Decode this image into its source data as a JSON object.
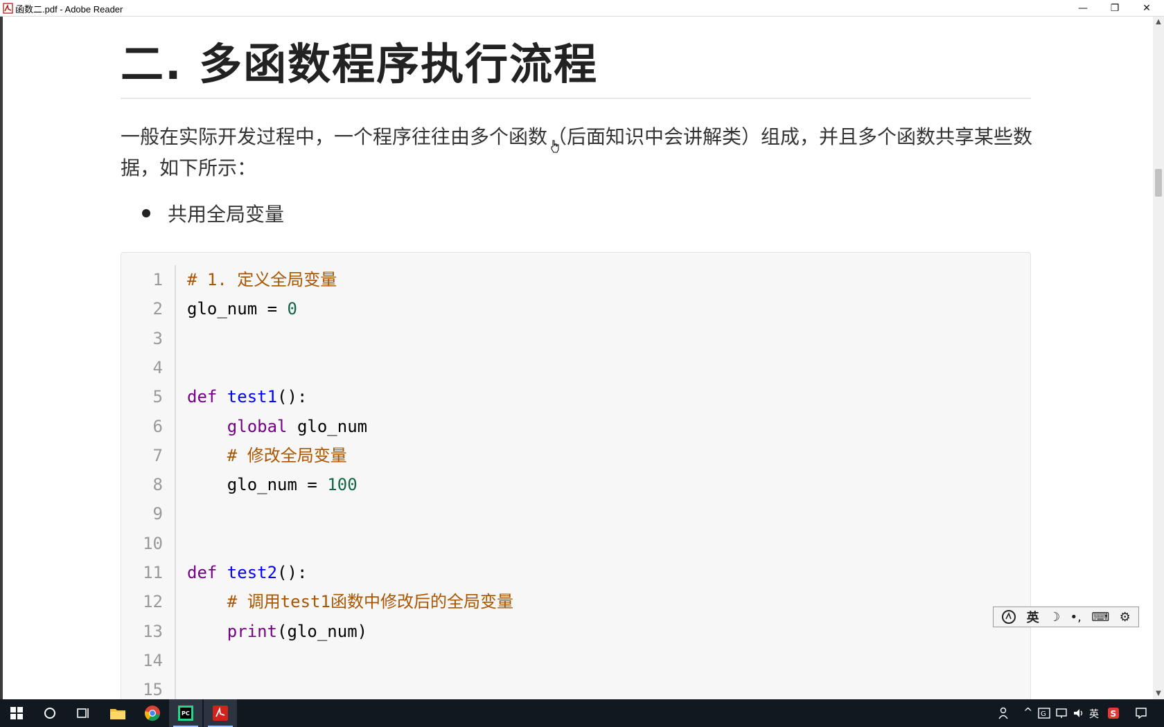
{
  "window": {
    "title": "函数二.pdf - Adobe Reader",
    "minimize_glyph": "—",
    "restore_glyph": "❐",
    "close_glyph": "✕"
  },
  "document": {
    "title": "二. 多函数程序执行流程",
    "paragraph": "一般在实际开发过程中，一个程序往往由多个函数（后面知识中会讲解类）组成，并且多个函数共享某些数据，如下所示：",
    "bullet": "共用全局变量",
    "code_lines": [
      {
        "n": "1",
        "tokens": [
          {
            "t": "# 1. 定义全局变量",
            "c": "c-comment"
          }
        ]
      },
      {
        "n": "2",
        "tokens": [
          {
            "t": "glo_num = ",
            "c": "c-plain"
          },
          {
            "t": "0",
            "c": "c-num"
          }
        ]
      },
      {
        "n": "3",
        "tokens": []
      },
      {
        "n": "4",
        "tokens": []
      },
      {
        "n": "5",
        "tokens": [
          {
            "t": "def ",
            "c": "c-kw"
          },
          {
            "t": "test1",
            "c": "c-def"
          },
          {
            "t": "():",
            "c": "c-plain"
          }
        ]
      },
      {
        "n": "6",
        "tokens": [
          {
            "t": "    ",
            "c": "c-plain"
          },
          {
            "t": "global",
            "c": "c-kw"
          },
          {
            "t": " glo_num",
            "c": "c-plain"
          }
        ]
      },
      {
        "n": "7",
        "tokens": [
          {
            "t": "    ",
            "c": "c-plain"
          },
          {
            "t": "# 修改全局变量",
            "c": "c-comment"
          }
        ]
      },
      {
        "n": "8",
        "tokens": [
          {
            "t": "    glo_num = ",
            "c": "c-plain"
          },
          {
            "t": "100",
            "c": "c-num"
          }
        ]
      },
      {
        "n": "9",
        "tokens": []
      },
      {
        "n": "10",
        "tokens": []
      },
      {
        "n": "11",
        "tokens": [
          {
            "t": "def ",
            "c": "c-kw"
          },
          {
            "t": "test2",
            "c": "c-def"
          },
          {
            "t": "():",
            "c": "c-plain"
          }
        ]
      },
      {
        "n": "12",
        "tokens": [
          {
            "t": "    ",
            "c": "c-plain"
          },
          {
            "t": "# 调用test1函数中修改后的全局变量",
            "c": "c-comment"
          }
        ]
      },
      {
        "n": "13",
        "tokens": [
          {
            "t": "    ",
            "c": "c-plain"
          },
          {
            "t": "print",
            "c": "c-kw"
          },
          {
            "t": "(glo_num)",
            "c": "c-plain"
          }
        ]
      },
      {
        "n": "14",
        "tokens": []
      },
      {
        "n": "15",
        "tokens": []
      }
    ]
  },
  "ime_toolbar": {
    "lang": "英",
    "moon": "☽",
    "punct": "•,",
    "keyboard": "⌨",
    "settings": "⚙"
  },
  "taskbar": {
    "tray_ime": "英",
    "chevron": "^"
  },
  "colors": {
    "comment": "#aa5500",
    "keyword": "#770088",
    "function_name": "#0000ff",
    "number": "#116644",
    "taskbar": "#101820"
  }
}
